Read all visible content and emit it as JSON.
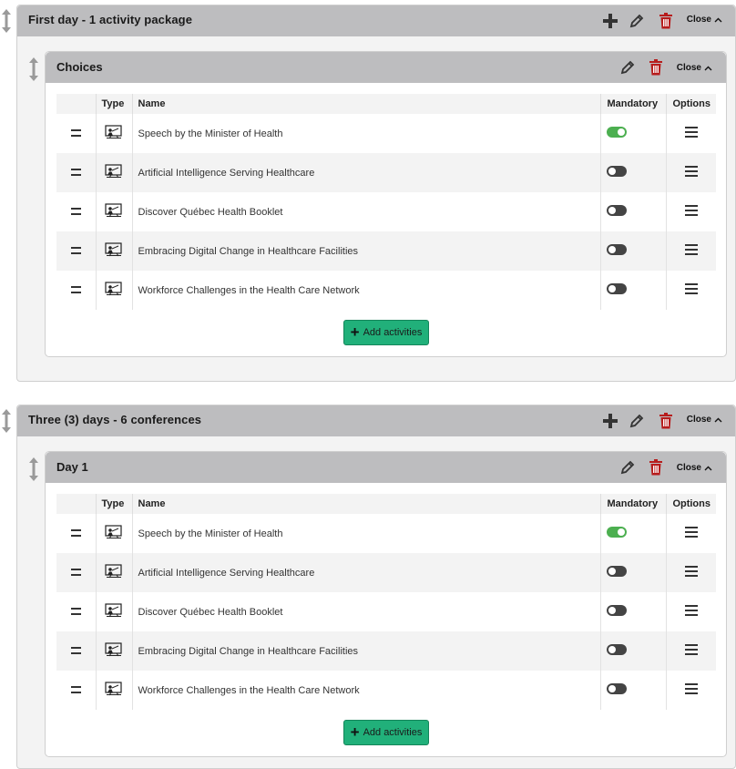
{
  "packages": [
    {
      "title": "First day - 1 activity package",
      "close_label": "Close",
      "group": {
        "title": "Choices",
        "close_label": "Close",
        "columns": {
          "type": "Type",
          "name": "Name",
          "mandatory": "Mandatory",
          "options": "Options"
        },
        "rows": [
          {
            "name": "Speech by the Minister of Health",
            "mandatory": true
          },
          {
            "name": "Artificial Intelligence Serving Healthcare",
            "mandatory": false
          },
          {
            "name": "Discover Québec Health Booklet",
            "mandatory": false
          },
          {
            "name": "Embracing Digital Change in Healthcare Facilities",
            "mandatory": false
          },
          {
            "name": "Workforce Challenges in the Health Care Network",
            "mandatory": false
          }
        ],
        "add_label": "Add activities"
      }
    },
    {
      "title": "Three (3) days - 6 conferences",
      "close_label": "Close",
      "group": {
        "title": "Day 1",
        "close_label": "Close",
        "columns": {
          "type": "Type",
          "name": "Name",
          "mandatory": "Mandatory",
          "options": "Options"
        },
        "rows": [
          {
            "name": "Speech by the Minister of Health",
            "mandatory": true
          },
          {
            "name": "Artificial Intelligence Serving Healthcare",
            "mandatory": false
          },
          {
            "name": "Discover Québec Health Booklet",
            "mandatory": false
          },
          {
            "name": "Embracing Digital Change in Healthcare Facilities",
            "mandatory": false
          },
          {
            "name": "Workforce Challenges in the Health Care Network",
            "mandatory": false
          }
        ],
        "add_label": "Add activities"
      }
    }
  ],
  "colors": {
    "header_bg": "#bdbdbf",
    "delete_red": "#b71c1c",
    "toggle_on": "#4caf50",
    "add_button": "#21b07a"
  },
  "icons": {
    "package_handle": "vertical-resize-arrow-icon",
    "add": "plus-icon",
    "edit": "pencil-icon",
    "delete": "trash-icon",
    "close_chevron": "chevron-up-icon",
    "row_drag": "drag-handle-icon",
    "type": "presentation-screen-icon",
    "options": "hamburger-menu-icon"
  }
}
